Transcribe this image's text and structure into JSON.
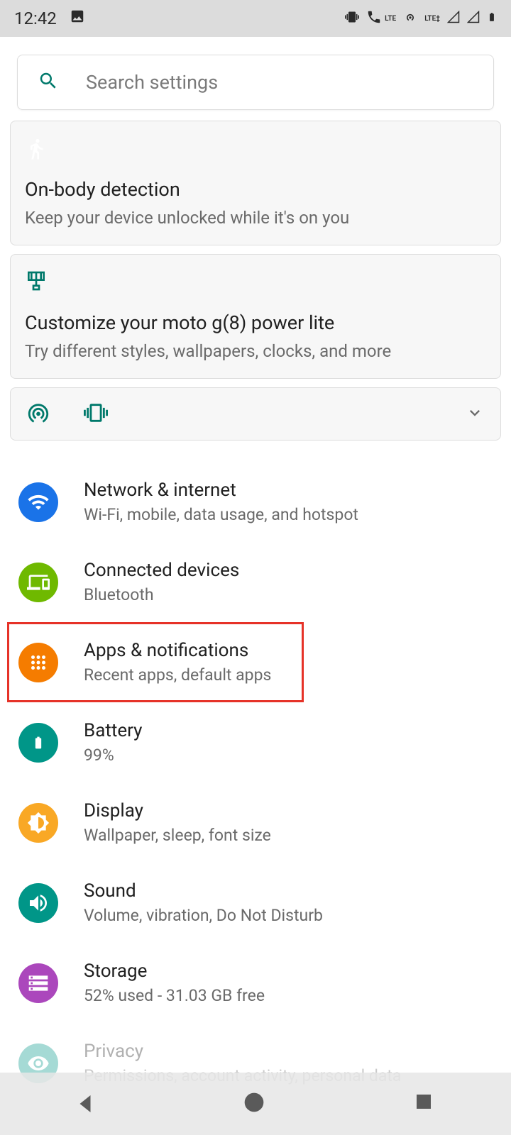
{
  "status": {
    "time": "12:42",
    "lte_label": "LTE"
  },
  "search": {
    "placeholder": "Search settings"
  },
  "cards": [
    {
      "title": "On-body detection",
      "subtitle": "Keep your device unlocked while it's on you"
    },
    {
      "title": "Customize your moto g(8) power lite",
      "subtitle": "Try different styles, wallpapers, clocks, and more"
    }
  ],
  "settings": [
    {
      "title": "Network & internet",
      "subtitle": "Wi-Fi, mobile, data usage, and hotspot"
    },
    {
      "title": "Connected devices",
      "subtitle": "Bluetooth"
    },
    {
      "title": "Apps & notifications",
      "subtitle": "Recent apps, default apps"
    },
    {
      "title": "Battery",
      "subtitle": "99%"
    },
    {
      "title": "Display",
      "subtitle": "Wallpaper, sleep, font size"
    },
    {
      "title": "Sound",
      "subtitle": "Volume, vibration, Do Not Disturb"
    },
    {
      "title": "Storage",
      "subtitle": "52% used - 31.03 GB free"
    },
    {
      "title": "Privacy",
      "subtitle": "Permissions, account activity, personal data"
    }
  ]
}
